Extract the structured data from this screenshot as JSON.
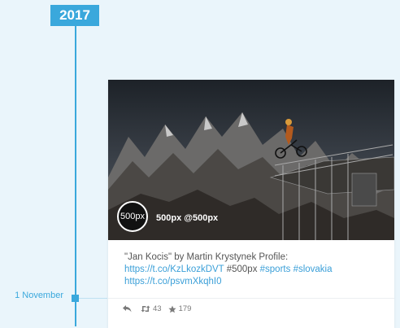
{
  "timeline": {
    "year": "2017",
    "date": "1 November"
  },
  "post": {
    "avatar_text": "500px",
    "author": "500px @500px",
    "text": {
      "intro": "\"Jan Kocis\" by Martin Krystynek Profile:",
      "link1": "https://t.co/KzLkozkDVT",
      "plain_tag": " #500px ",
      "tag_sports": "#sports",
      "tag_slovakia": "#slovakia",
      "link2": "https://t.co/psvmXkqhI0"
    },
    "retweet_count": "43",
    "like_count": "179"
  },
  "icons": {
    "reply": "reply-icon",
    "retweet": "retweet-icon",
    "like": "star-icon"
  },
  "colors": {
    "accent": "#3aa8dc",
    "link": "#3a9fd8",
    "background": "#eaf5fb"
  }
}
